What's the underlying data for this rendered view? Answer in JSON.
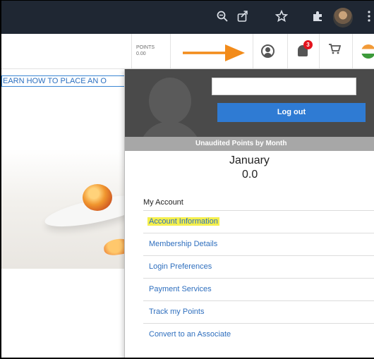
{
  "header": {
    "points_label": "POINTS",
    "points_value": "0.00",
    "notification_count": "3"
  },
  "banner": {
    "text": "EARN HOW TO PLACE AN O"
  },
  "account_menu": {
    "logout_label": "Log out",
    "name_field_value": "",
    "points_heading": "Unaudited Points by Month",
    "month": "January",
    "month_points": "0.0",
    "section_title": "My Account",
    "items": [
      {
        "label": "Account Information",
        "highlighted": true
      },
      {
        "label": "Membership Details"
      },
      {
        "label": "Login Preferences"
      },
      {
        "label": "Payment Services"
      },
      {
        "label": "Track my Points"
      },
      {
        "label": "Convert to an Associate"
      }
    ]
  },
  "colors": {
    "browser_bar": "#1f2733",
    "annotation_arrow": "#f28b1a",
    "link_blue": "#2f6fbe",
    "logout_button": "#2f7bd3",
    "highlight": "#f5f04c",
    "badge_red": "#e4141e"
  },
  "icons": {
    "browser": [
      "zoom-icon",
      "share-icon",
      "star-icon",
      "extensions-icon",
      "profile-avatar",
      "menu-kebab-icon"
    ],
    "header": [
      "account-icon",
      "bell-icon",
      "cart-icon",
      "india-flag-icon"
    ]
  }
}
